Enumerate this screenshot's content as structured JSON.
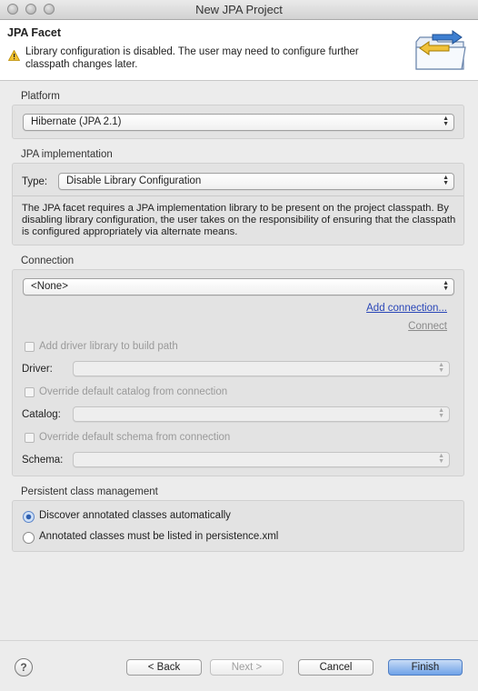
{
  "window": {
    "title": "New JPA Project"
  },
  "header": {
    "title": "JPA Facet",
    "message": "Library configuration is disabled. The user may need to configure further classpath changes later.",
    "warning_icon": "warning-icon",
    "wizard_icon": "folder-arrows-icon"
  },
  "platform": {
    "group_label": "Platform",
    "selected": "Hibernate (JPA 2.1)"
  },
  "jpa_impl": {
    "group_label": "JPA implementation",
    "type_label": "Type:",
    "type_selected": "Disable Library Configuration",
    "description": "The JPA facet requires a JPA implementation library to be present on the project classpath. By disabling library configuration, the user takes on the responsibility of ensuring that the classpath is configured appropriately via alternate means."
  },
  "connection": {
    "group_label": "Connection",
    "selected": "<None>",
    "add_link": "Add connection...",
    "connect_link": "Connect",
    "add_driver_label": "Add driver library to build path",
    "driver_label": "Driver:",
    "override_catalog_label": "Override default catalog from connection",
    "catalog_label": "Catalog:",
    "override_schema_label": "Override default schema from connection",
    "schema_label": "Schema:"
  },
  "persistent": {
    "group_label": "Persistent class management",
    "option_discover": "Discover annotated classes automatically",
    "option_listed": "Annotated classes must be listed in persistence.xml",
    "selected_option": "discover"
  },
  "buttons": {
    "help": "?",
    "back": "< Back",
    "next": "Next >",
    "cancel": "Cancel",
    "finish": "Finish"
  }
}
